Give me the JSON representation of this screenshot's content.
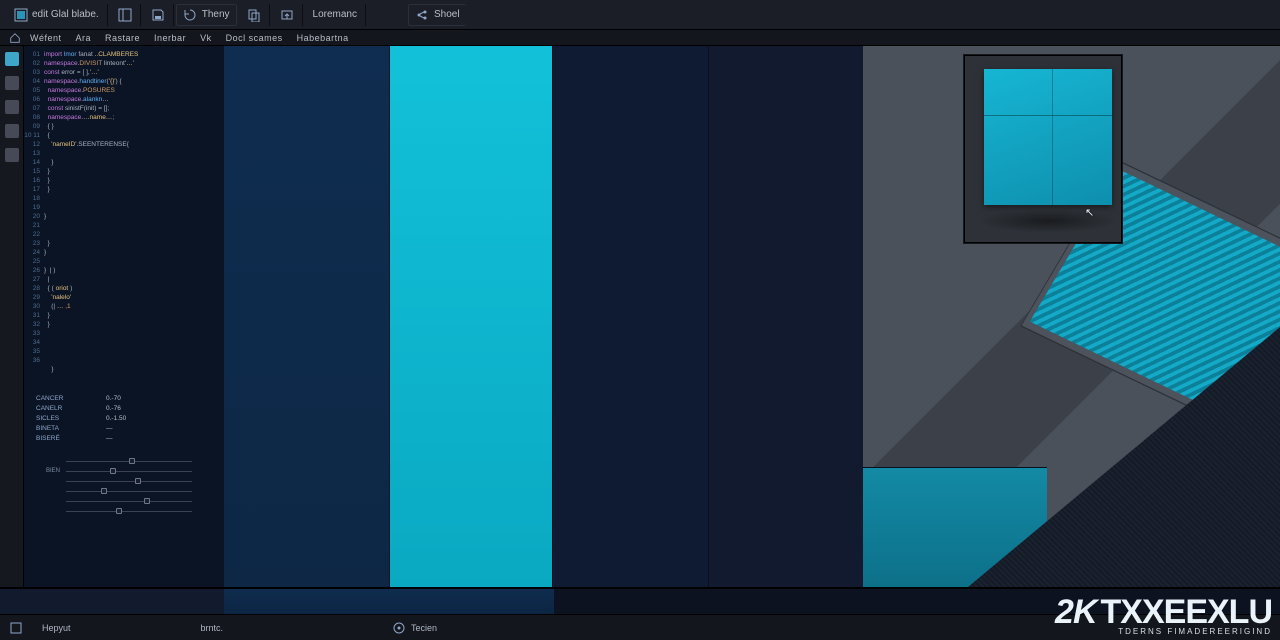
{
  "toolbar": {
    "title": "edit Glal blabe.",
    "btn_theme": "Theny",
    "btn_lorem": "Loremanc",
    "btn_show": "Shoel"
  },
  "menu": {
    "items": [
      "Wéfent",
      "Ara",
      "Rastare",
      "Inerbar",
      "Vk",
      "Docl scames",
      "Habebartna"
    ]
  },
  "code": {
    "lines": [
      {
        "n": "01",
        "t": "<span class='tok-k'>import</span> <span class='tok-f'>lmor</span> <span class='tok-p'>fanat</span> <span class='tok-s'>..CLAMBERES</span>"
      },
      {
        "n": "02",
        "t": "<span class='tok-k'>namespace</span><span class='tok-p'>.</span><span class='tok-n'>DIVISIT</span> <span class='tok-p'>linteont</span><span class='tok-s'>&apos;…&apos;</span>"
      },
      {
        "n": "03",
        "t": "<span class='tok-k'>const</span> <span class='tok-p'>error</span> <span class='tok-p'>=</span> <span class='tok-p'>[ ],</span><span class='tok-s'>&apos;…&apos;</span>"
      },
      {
        "n": "04",
        "t": "<span class='tok-k'>namespace</span><span class='tok-p'>.</span><span class='tok-f'>handtiner</span><span class='tok-p'>(</span><span class='tok-s'>&apos;{}&apos;</span><span class='tok-p'>)</span> <span class='tok-p'>{</span>"
      },
      {
        "n": "05",
        "t": "  <span class='tok-k'>namespace</span><span class='tok-p'>.</span><span class='tok-n'>POSURES</span>"
      },
      {
        "n": "06",
        "t": "  <span class='tok-k'>namespace</span><span class='tok-p'>.</span><span class='tok-f'>alankn</span><span class='tok-p'>…</span>"
      },
      {
        "n": "07",
        "t": "  <span class='tok-k'>const</span> <span class='tok-p'>sinistF(init) = [];</span>"
      },
      {
        "n": "08",
        "t": "  <span class='tok-k'>namespace</span><span class='tok-p'>.</span><span class='tok-s'>…name…</span><span class='tok-p'>;</span>"
      },
      {
        "n": "09",
        "t": "  <span class='tok-p'>{ }</span>"
      },
      {
        "n": "10",
        "t": "  <span class='tok-p'>{</span>"
      },
      {
        "n": "11",
        "t": "    <span class='tok-s'>&apos;nameID&apos;</span><span class='tok-p'>.SEENTERENSE{</span>"
      },
      {
        "n": "12",
        "t": ""
      },
      {
        "n": "13",
        "t": "    <span class='tok-p'>}</span>"
      },
      {
        "n": "14",
        "t": "  <span class='tok-p'>}</span>"
      },
      {
        "n": "15",
        "t": "  <span class='tok-p'>}</span>"
      },
      {
        "n": "16",
        "t": "  <span class='tok-p'>}</span>"
      },
      {
        "n": "17",
        "t": ""
      },
      {
        "n": "18",
        "t": ""
      },
      {
        "n": "19",
        "t": "<span class='tok-p'>}</span>"
      },
      {
        "n": "20",
        "t": ""
      },
      {
        "n": "21",
        "t": ""
      },
      {
        "n": "22",
        "t": "  <span class='tok-p'>}</span>"
      },
      {
        "n": "23",
        "t": "<span class='tok-p'>}</span>"
      },
      {
        "n": "24",
        "t": ""
      },
      {
        "n": "25",
        "t": "<span class='tok-p'>}  | )</span>"
      },
      {
        "n": "26",
        "t": "  <span class='tok-p'>|</span>"
      },
      {
        "n": "27",
        "t": "  <span class='tok-p'>{ (</span> <span class='tok-s'>oriot</span> <span class='tok-p'>)</span>"
      },
      {
        "n": "28",
        "t": "    <span class='tok-s'>&apos;nalelo&apos;</span>"
      },
      {
        "n": "29",
        "t": "    <span class='tok-p'>(</span><span class='tok-p'>|</span> <span class='tok-s'>…</span> <span class='tok-n'>,1</span>"
      },
      {
        "n": "30",
        "t": "  <span class='tok-p'>}</span>"
      },
      {
        "n": "31",
        "t": "  <span class='tok-p'>}</span>"
      },
      {
        "n": "32",
        "t": ""
      },
      {
        "n": "33",
        "t": ""
      },
      {
        "n": "34",
        "t": ""
      },
      {
        "n": "35",
        "t": ""
      },
      {
        "n": "36",
        "t": "    <span class='tok-p'>}</span>"
      }
    ]
  },
  "vars": {
    "rows": [
      {
        "k": "CANCER",
        "v": "0.-70"
      },
      {
        "k": "CANELR",
        "v": "0.-76"
      },
      {
        "k": "SICLES",
        "v": "0.-1.50"
      },
      {
        "k": "BINETA",
        "v": "—"
      },
      {
        "k": "BISERÉ",
        "v": "—"
      }
    ]
  },
  "sliders": [
    {
      "label": "",
      "pos": 50
    },
    {
      "label": "BIEN",
      "pos": 35
    },
    {
      "label": "",
      "pos": 55
    },
    {
      "label": "",
      "pos": 28
    },
    {
      "label": "",
      "pos": 62
    },
    {
      "label": "",
      "pos": 40
    }
  ],
  "status": {
    "left": "Hepyut",
    "mid": "brntc.",
    "right": "Tecien"
  },
  "watermark": {
    "logo": "2K",
    "brand": "TXXEEXLU",
    "sub": "TDERNS FIMADEREERIGIND"
  },
  "colors": {
    "cyan": "#12c1d9",
    "deep_blue": "#0f2d50",
    "navy": "#0e1b33",
    "teal_panel": "#138aa5",
    "chrome": "#14161d"
  }
}
